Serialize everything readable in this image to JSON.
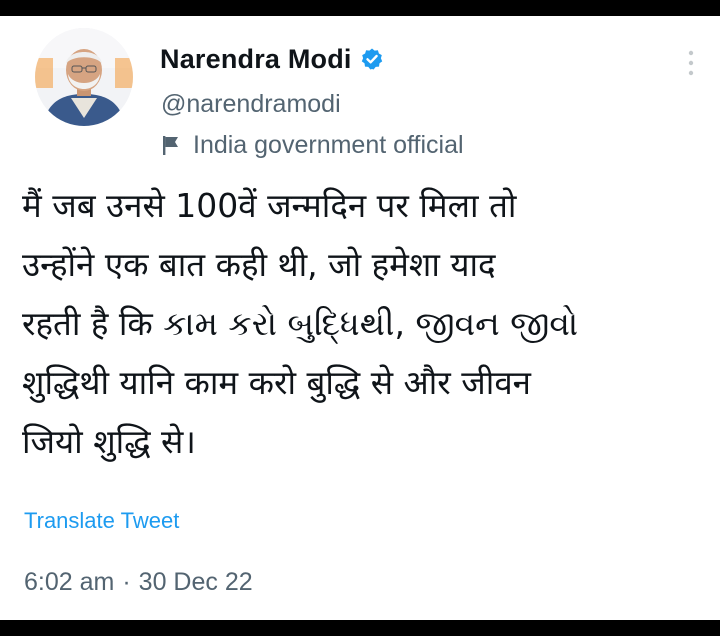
{
  "author": {
    "display_name": "Narendra Modi",
    "handle": "@narendramodi",
    "label": "India government official",
    "verified_icon": "verified-badge-icon",
    "label_icon": "flag-icon",
    "avatar_icon": "profile-photo"
  },
  "tweet": {
    "lines": [
      "मैं जब उनसे 100वें जन्मदिन पर मिला तो",
      "उन्होंने एक बात कही थी, जो हमेशा याद",
      "रहती है कि કામ કરો બુદ્ધિથી, જીવન જીવો",
      "शुद्धिथी यानि काम करो बुद्धि से और जीवन",
      "जियो शुद्धि से।"
    ],
    "translate_label": "Translate Tweet",
    "time": "6:02 am",
    "separator": "·",
    "date": "30 Dec 22"
  },
  "colors": {
    "text": "#0f1419",
    "secondary": "#536471",
    "link": "#1d9bf0",
    "verified": "#1d9bf0"
  },
  "menu_icon": "more-vertical-icon"
}
